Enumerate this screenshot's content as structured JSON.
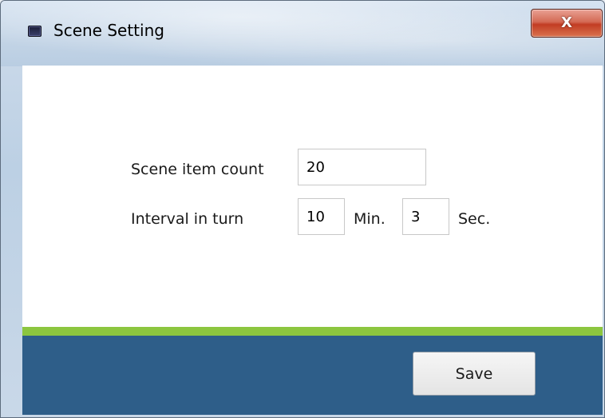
{
  "window": {
    "title": "Scene Setting",
    "close_glyph": "X",
    "icon": "app-window-icon"
  },
  "form": {
    "scene_item_count_label": "Scene item count",
    "scene_item_count_value": "20",
    "interval_label": "Interval in turn",
    "interval_minutes_value": "10",
    "minutes_unit": "Min.",
    "interval_seconds_value": "3",
    "seconds_unit": "Sec."
  },
  "footer": {
    "save_label": "Save"
  },
  "colors": {
    "accent_green": "#8cc63f",
    "footer_blue": "#2e5e89",
    "close_red": "#c23c23"
  }
}
